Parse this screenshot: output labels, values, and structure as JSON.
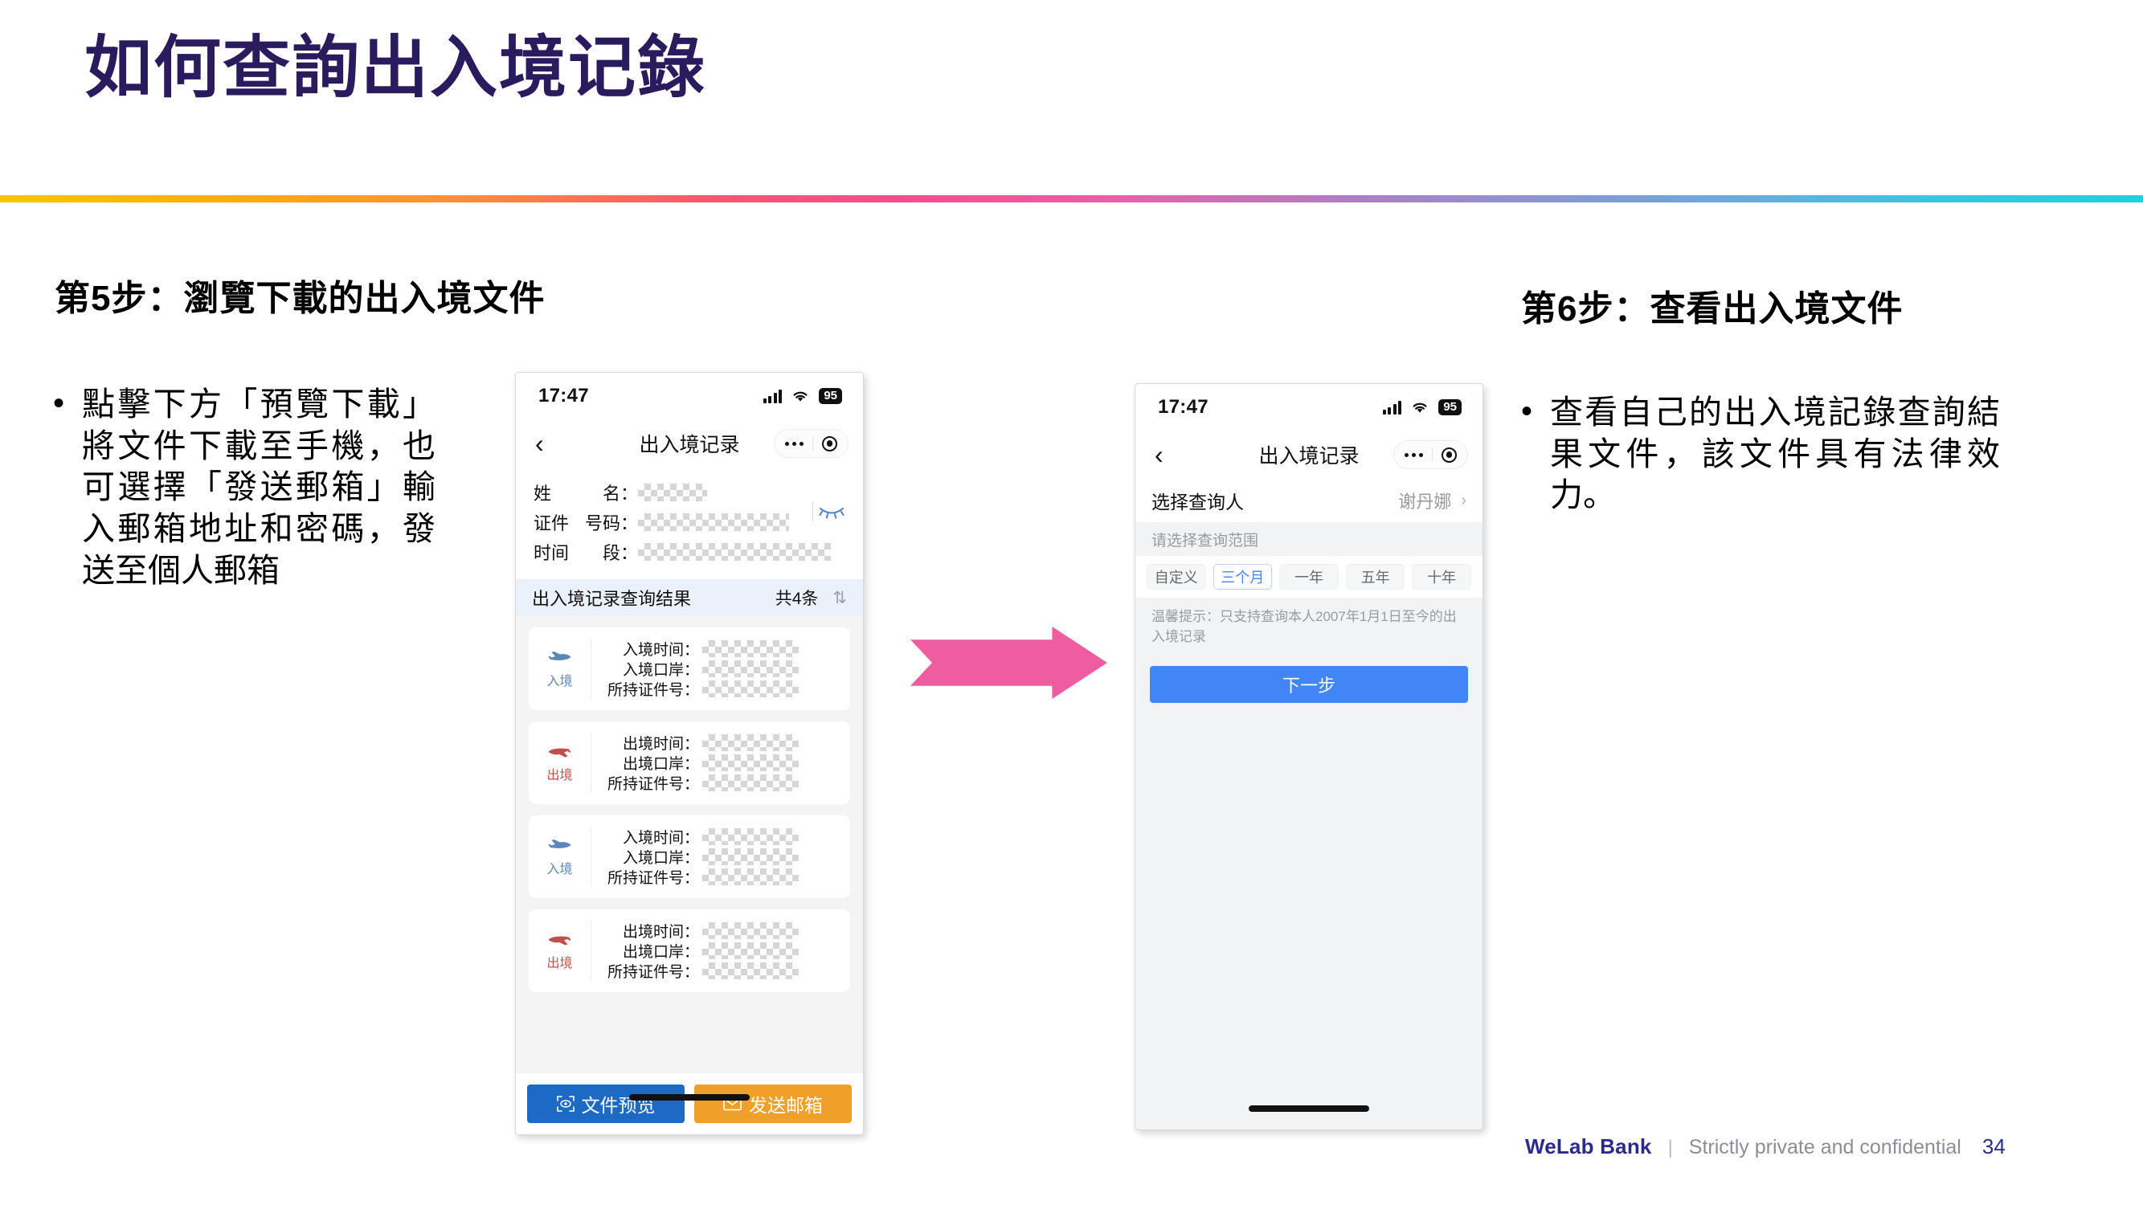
{
  "slide": {
    "title": "如何查詢出入境记錄",
    "page_number": "34"
  },
  "footer": {
    "brand": "WeLab Bank",
    "separator": "|",
    "note": "Strictly private and confidential"
  },
  "step5": {
    "heading": "第5步：瀏覽下載的出入境文件",
    "bullet_marker": "•",
    "bullet": "點擊下方「預覽下載」將文件下載至手機，也可選擇「發送郵箱」輸入郵箱地址和密碼，發送至個人郵箱"
  },
  "step6": {
    "heading": "第6步：查看出入境文件",
    "bullet_marker": "•",
    "bullet": "查看自己的出入境記錄查詢結果文件，該文件具有法律效力。"
  },
  "arrow": {
    "name": "flow-arrow",
    "color": "#ef5da0"
  },
  "phone1": {
    "status": {
      "time": "17:47",
      "battery": "95",
      "signal_icon": "cellular-signal-icon",
      "wifi_icon": "wifi-icon"
    },
    "nav": {
      "back_icon": "‹",
      "title": "出入境记录",
      "more_icon": "more-dots-icon",
      "target_icon": "target-icon"
    },
    "info": {
      "rows": [
        {
          "label_parts": [
            "姓",
            "名："
          ],
          "masked": true
        },
        {
          "label_parts": [
            "证件",
            "号码："
          ],
          "masked": true
        },
        {
          "label_parts": [
            "时间",
            "段："
          ],
          "masked": true
        }
      ],
      "eye_icon": "eye-closed-icon"
    },
    "result_header": {
      "title": "出入境记录查询结果",
      "count": "共4条",
      "sort_icon": "⇅"
    },
    "records": [
      {
        "type": "入境",
        "direction": "in",
        "plane_icon": "plane-arrival-icon",
        "fields": [
          "入境时间：",
          "入境口岸：",
          "所持证件号："
        ]
      },
      {
        "type": "出境",
        "direction": "out",
        "plane_icon": "plane-departure-icon",
        "fields": [
          "出境时间：",
          "出境口岸：",
          "所持证件号："
        ]
      },
      {
        "type": "入境",
        "direction": "in",
        "plane_icon": "plane-arrival-icon",
        "fields": [
          "入境时间：",
          "入境口岸：",
          "所持证件号："
        ]
      },
      {
        "type": "出境",
        "direction": "out",
        "plane_icon": "plane-departure-icon",
        "fields": [
          "出境时间：",
          "出境口岸：",
          "所持证件号："
        ]
      }
    ],
    "actions": {
      "preview": {
        "label": "文件预览",
        "icon": "scan-eye-icon",
        "color": "#1d6ac4"
      },
      "email": {
        "label": "发送邮箱",
        "icon": "envelope-icon",
        "color": "#f0a028"
      }
    }
  },
  "phone2": {
    "status": {
      "time": "17:47",
      "battery": "95",
      "signal_icon": "cellular-signal-icon",
      "wifi_icon": "wifi-icon"
    },
    "nav": {
      "back_icon": "‹",
      "title": "出入境记录",
      "more_icon": "more-dots-icon",
      "target_icon": "target-icon"
    },
    "person_row": {
      "label": "选择查询人",
      "value": "谢丹娜",
      "chevron": "›"
    },
    "range_label": "请选择查询范围",
    "range_chips": [
      {
        "label": "自定义",
        "selected": false
      },
      {
        "label": "三个月",
        "selected": true
      },
      {
        "label": "一年",
        "selected": false
      },
      {
        "label": "五年",
        "selected": false
      },
      {
        "label": "十年",
        "selected": false
      }
    ],
    "tip": "温馨提示：只支持查询本人2007年1月1日至今的出入境记录",
    "next_button": {
      "label": "下一步",
      "color": "#4285f4"
    }
  }
}
